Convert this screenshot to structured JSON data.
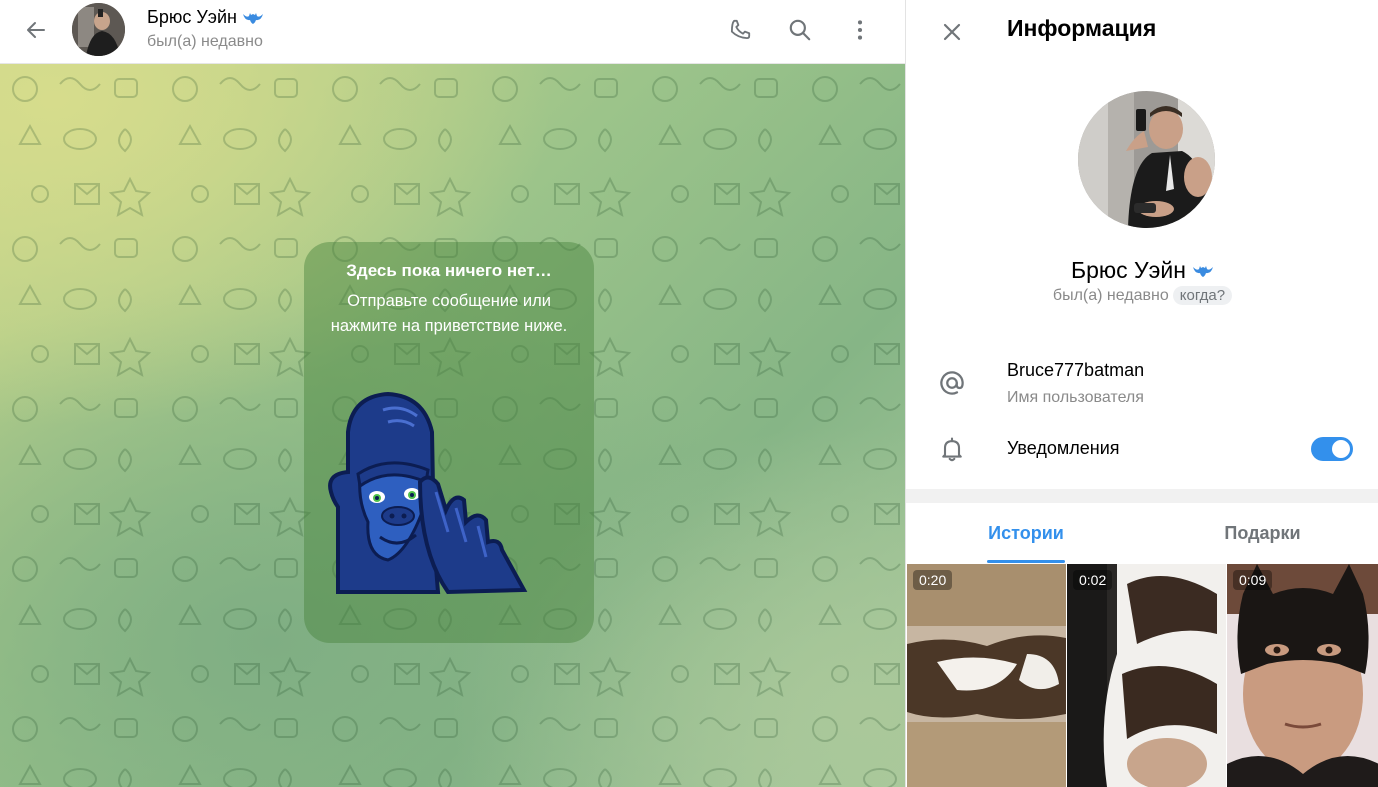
{
  "chat_header": {
    "name": "Брюс Уэйн",
    "status": "был(а) недавно",
    "verified_icon": "batman-emoji-status-icon",
    "buttons": [
      "back-icon",
      "phone-icon",
      "search-icon",
      "more-vertical-icon"
    ]
  },
  "empty_chat": {
    "title": "Здесь пока ничего нет…",
    "description": "Отправьте сообщение или нажмите на приветствие ниже.",
    "sticker": "gorilla-sticker"
  },
  "info_panel": {
    "title": "Информация",
    "name": "Брюс Уэйн",
    "status": "был(а) недавно",
    "when_badge": "когда?",
    "username": "Bruce777batman",
    "username_label": "Имя пользователя",
    "notifications_label": "Уведомления",
    "notifications_on": true,
    "tabs": [
      {
        "label": "Истории",
        "active": true
      },
      {
        "label": "Подарки",
        "active": false
      }
    ],
    "stories": [
      {
        "duration": "0:20"
      },
      {
        "duration": "0:02"
      },
      {
        "duration": "0:09"
      }
    ]
  },
  "colors": {
    "accent": "#3390ec",
    "secondary_text": "#8a8a8a"
  }
}
